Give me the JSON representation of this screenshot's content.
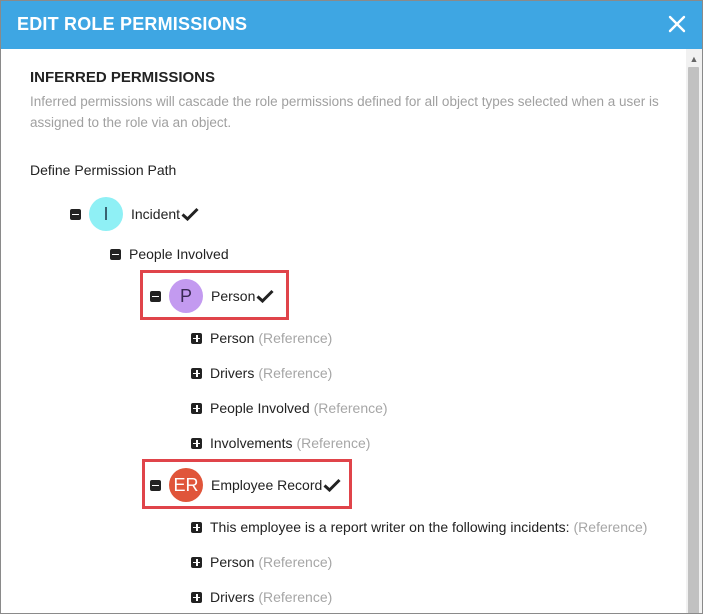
{
  "dialog": {
    "title": "EDIT ROLE PERMISSIONS",
    "close_icon": "close-icon"
  },
  "section": {
    "title": "INFERRED PERMISSIONS",
    "description": "Inferred permissions will cascade the role permissions defined for all object types selected when a user is assigned to the role via an object.",
    "path_label": "Define Permission Path"
  },
  "tree": {
    "incident": {
      "initial": "I",
      "label": "Incident",
      "avatar_color": "#8ff0f5"
    },
    "people_involved": {
      "label": "People Involved"
    },
    "person": {
      "initial": "P",
      "label": "Person",
      "avatar_color": "#c39af0"
    },
    "person_children": [
      {
        "label": "Person",
        "ref": "(Reference)"
      },
      {
        "label": "Drivers",
        "ref": "(Reference)"
      },
      {
        "label": "People Involved",
        "ref": "(Reference)"
      },
      {
        "label": "Involvements",
        "ref": "(Reference)"
      }
    ],
    "employee_record": {
      "initial": "ER",
      "label": "Employee Record",
      "avatar_color": "#e0553a"
    },
    "employee_children": [
      {
        "label": "This employee is a report writer on the following incidents:",
        "ref": "(Reference)"
      },
      {
        "label": "Person",
        "ref": "(Reference)"
      },
      {
        "label": "Drivers",
        "ref": "(Reference)"
      }
    ]
  },
  "colors": {
    "titlebar": "#3ea6e3",
    "highlight": "#e0444a"
  }
}
